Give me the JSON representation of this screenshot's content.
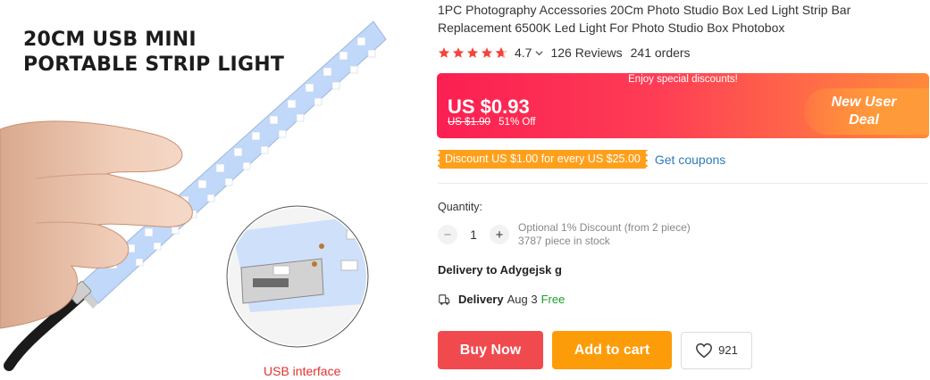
{
  "product_image": {
    "headline_line1": "20CM USB MINI",
    "headline_line2": "PORTABLE STRIP LIGHT",
    "caption": "USB interface"
  },
  "title": "1PC Photography Accessories 20Cm Photo Studio Box Led Light Strip Bar Replacement 6500K Led Light For Photo Studio Box Photobox",
  "rating": {
    "value": "4.7",
    "stars": 4.7,
    "reviews": "126 Reviews",
    "orders": "241 orders"
  },
  "price_banner": {
    "tag": "Enjoy special discounts!",
    "price": "US $0.93",
    "original_price": "US $1.90",
    "discount": "51% Off",
    "new_user_line1": "New User",
    "new_user_line2": "Deal"
  },
  "coupon": {
    "badge": "Discount US $1.00 for every US $25.00",
    "link": "Get coupons"
  },
  "quantity": {
    "label": "Quantity:",
    "minus": "−",
    "value": "1",
    "plus": "+",
    "note_line1": "Optional 1% Discount (from 2 piece)",
    "note_line2": "3787 piece in stock"
  },
  "delivery": {
    "to": "Delivery to Adygejsk g",
    "label": "Delivery",
    "date": "Aug 3",
    "free": "Free"
  },
  "actions": {
    "buy_now": "Buy Now",
    "add_to_cart": "Add to cart",
    "wishlist_count": "921"
  },
  "colors": {
    "star": "#f5443c",
    "buy": "#f04a4f",
    "cart": "#fd9c09",
    "coupon": "#ffa01c",
    "link": "#2e7bbd",
    "free": "#1a9e2c"
  },
  "icons": [
    "star-icon",
    "chevron-down-icon",
    "truck-icon",
    "heart-icon"
  ]
}
